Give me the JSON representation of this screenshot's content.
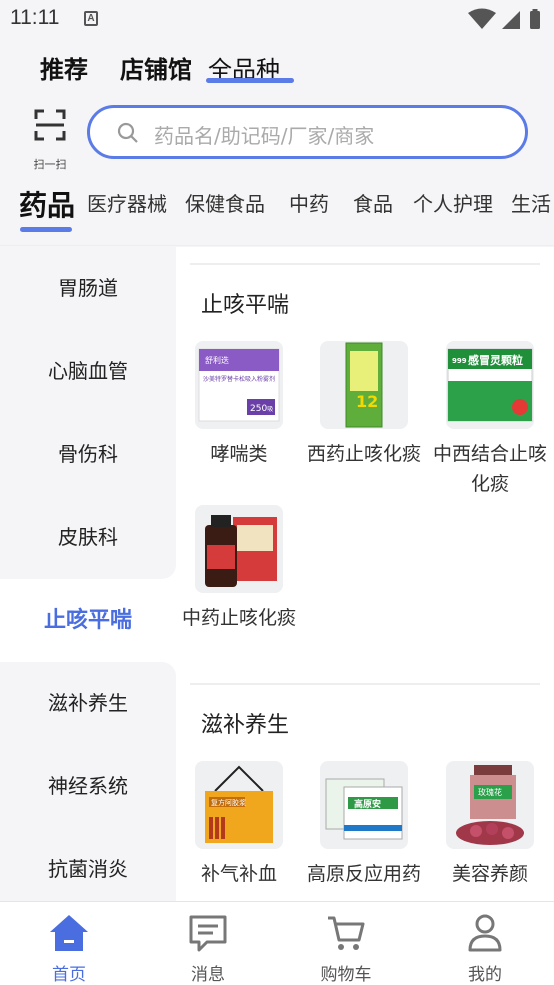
{
  "status_bar": {
    "time": "11:11",
    "notification_icon": "a-box-icon",
    "signal_icons": [
      "wifi-icon",
      "cellular-icon",
      "battery-icon"
    ]
  },
  "top_tabs": [
    {
      "label": "推荐"
    },
    {
      "label": "店铺馆"
    },
    {
      "label": "全品种"
    }
  ],
  "scan": {
    "label": "扫一扫",
    "icon": "scan-icon"
  },
  "search": {
    "placeholder": "药品名/助记码/厂家/商家",
    "icon": "search-icon"
  },
  "categories": [
    {
      "label": "药品"
    },
    {
      "label": "医疗器械"
    },
    {
      "label": "保健食品"
    },
    {
      "label": "中药"
    },
    {
      "label": "食品"
    },
    {
      "label": "个人护理"
    },
    {
      "label": "生活"
    }
  ],
  "sidebar": [
    {
      "label": "胃肠道"
    },
    {
      "label": "心脑血管"
    },
    {
      "label": "骨伤科"
    },
    {
      "label": "皮肤科"
    },
    {
      "label": "止咳平喘"
    },
    {
      "label": "滋补养生"
    },
    {
      "label": "神经系统"
    },
    {
      "label": "抗菌消炎"
    }
  ],
  "sections": [
    {
      "title": "止咳平喘",
      "products": [
        {
          "name": "哮喘类",
          "box_text": "沙美特罗替卡松吸入粉雾剂",
          "box_count": "250",
          "box_unit": "吸"
        },
        {
          "name": "西药止咳化痰",
          "box_text": "12"
        },
        {
          "name": "中西结合止咳化痰",
          "box_text": "感冒灵颗粒",
          "box_brand": "999"
        },
        {
          "name": "中药止咳化痰"
        }
      ]
    },
    {
      "title": "滋补养生",
      "products": [
        {
          "name": "补气补血",
          "box_text": "复方阿胶浆"
        },
        {
          "name": "高原反应用药",
          "box_text": "高原安"
        },
        {
          "name": "美容养颜",
          "box_text": "玫瑰花"
        }
      ]
    }
  ],
  "bottom_nav": [
    {
      "label": "首页",
      "icon": "home-icon"
    },
    {
      "label": "消息",
      "icon": "message-icon"
    },
    {
      "label": "购物车",
      "icon": "cart-icon"
    },
    {
      "label": "我的",
      "icon": "user-icon"
    }
  ],
  "colors": {
    "accent": "#4a6ee0",
    "search_border": "#5b7be6",
    "background": "#f5f5f7"
  }
}
